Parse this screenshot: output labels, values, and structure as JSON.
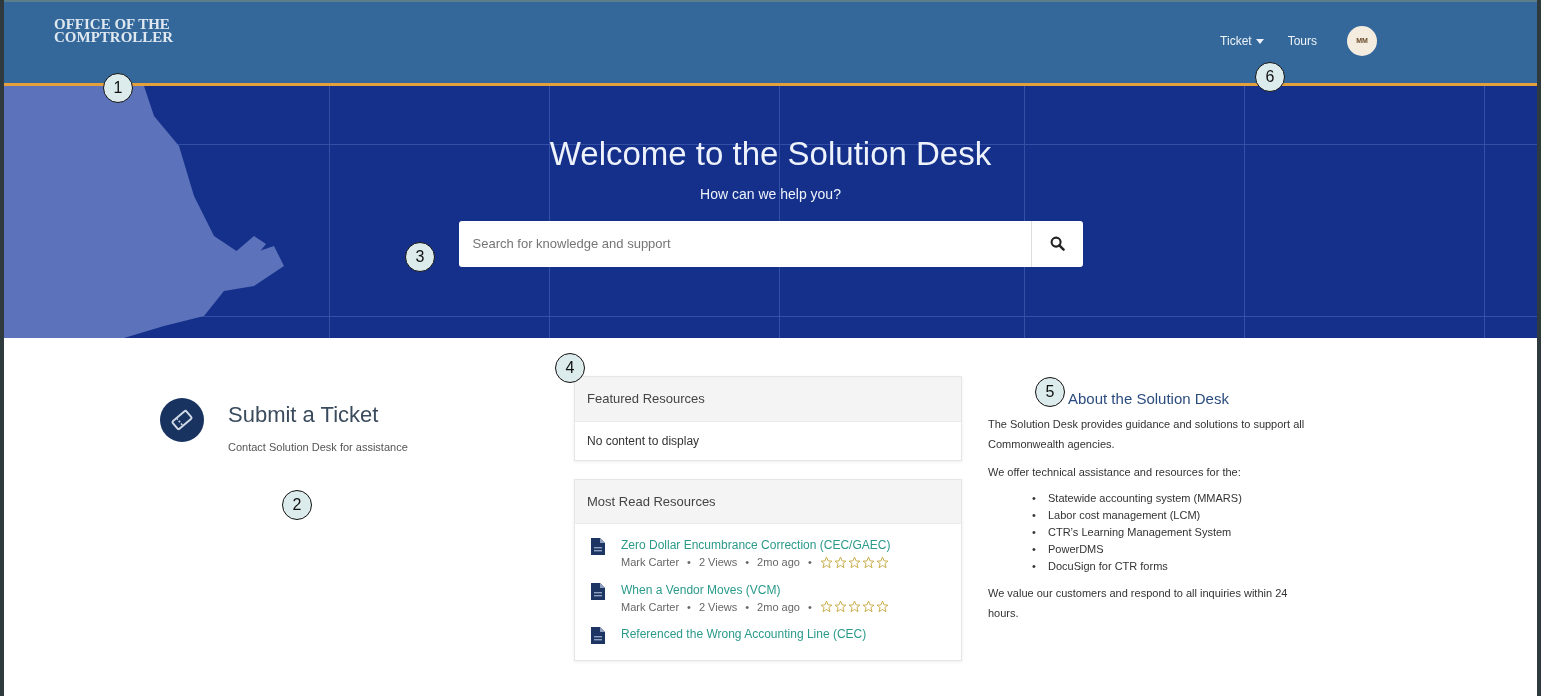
{
  "navbar": {
    "logo": [
      "OFFICE OF THE",
      "COMPTROLLER"
    ],
    "links": [
      {
        "label": "Ticket",
        "kind": "dropdown"
      },
      {
        "label": "Tours",
        "kind": "link"
      }
    ],
    "avatar": "MM"
  },
  "hero": {
    "title": "Welcome to the Solution Desk",
    "subtitle": "How can we help you?",
    "search": {
      "placeholder": "Search for knowledge and support"
    }
  },
  "submit": {
    "title": "Submit a Ticket",
    "text": "Contact Solution Desk for assistance"
  },
  "featured": {
    "title": "Featured Resources",
    "empty": "No content to display"
  },
  "most_read": {
    "title": "Most Read Resources",
    "items": [
      {
        "title": "Zero Dollar Encumbrance Correction (CEC/GAEC)",
        "author": "Mark Carter",
        "views": "2 Views",
        "age": "2mo ago",
        "separator": "•",
        "stars": 0
      },
      {
        "title": "When a Vendor Moves (VCM)",
        "author": "Mark Carter",
        "views": "2 Views",
        "age": "2mo ago",
        "separator": "•",
        "stars": 0
      },
      {
        "title": "Referenced the Wrong Accounting Line (CEC)"
      }
    ]
  },
  "about": {
    "title": "About the Solution Desk",
    "intro": "The Solution Desk provides guidance and solutions to support all Commonwealth agencies.",
    "lead": "We offer technical assistance and resources for the:",
    "bullet": "•",
    "items": [
      "Statewide accounting system (MMARS)",
      "Labor cost management (LCM)",
      "CTR’s Learning Management System",
      "PowerDMS",
      "DocuSign for CTR forms"
    ],
    "outro": "We value our customers and respond to all inquiries within 24 hours."
  },
  "callouts": [
    "1",
    "2",
    "3",
    "4",
    "5",
    "6"
  ]
}
